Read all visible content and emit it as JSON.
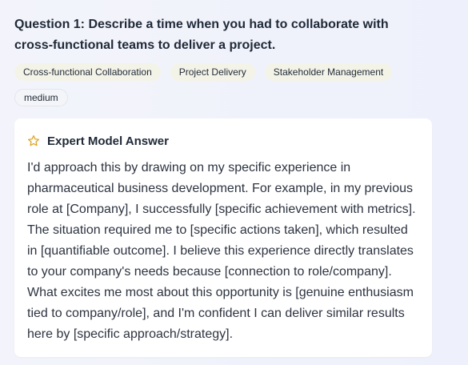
{
  "question": {
    "text": "Question 1: Describe a time when you had to collaborate with cross-functional teams to deliver a project."
  },
  "tags": {
    "topics": [
      "Cross-functional Collaboration",
      "Project Delivery",
      "Stakeholder Management"
    ],
    "difficulty": "medium"
  },
  "answer_card": {
    "icon": "star-outline-icon",
    "accent_color": "#e0a72b",
    "title": "Expert Model Answer",
    "body": "I'd approach this by drawing on my specific experience in pharmaceutical business development. For example, in my previous role at [Company], I successfully [specific achievement with metrics]. The situation required me to [specific actions taken], which resulted in [quantifiable outcome]. I believe this experience directly translates to your company's needs because [connection to role/company]. What excites me most about this opportunity is [genuine enthusiasm tied to company/role], and I'm confident I can deliver similar results here by [specific approach/strategy]."
  }
}
